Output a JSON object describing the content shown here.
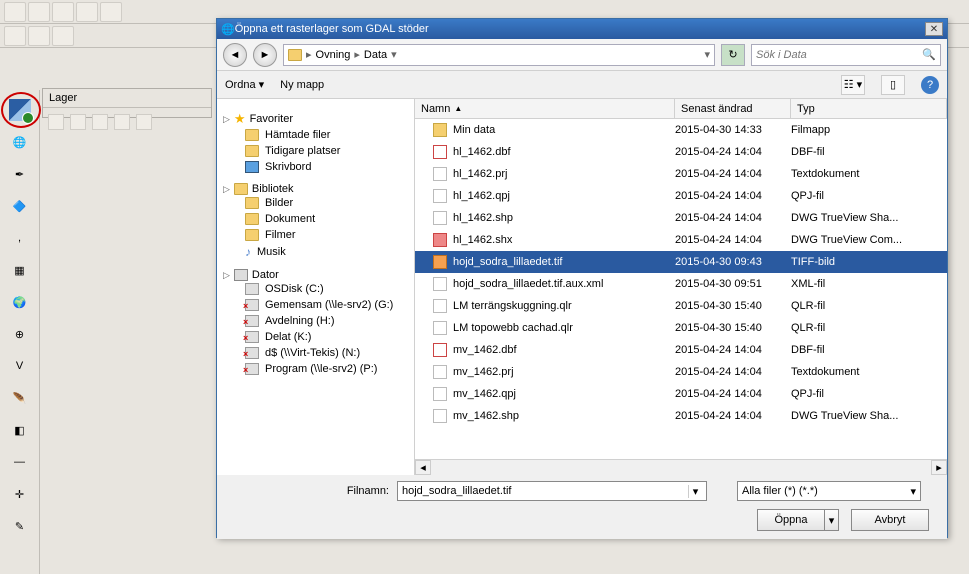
{
  "bgapp": {
    "lager_title": "Lager"
  },
  "dialog": {
    "title": "Öppna ett rasterlager som GDAL stöder",
    "breadcrumb": [
      "Ovning",
      "Data"
    ],
    "search_placeholder": "Sök i Data",
    "cmd_sort": "Ordna",
    "cmd_newfolder": "Ny mapp",
    "nav": {
      "fav_hdr": "Favoriter",
      "fav_items": [
        "Hämtade filer",
        "Tidigare platser",
        "Skrivbord"
      ],
      "lib_hdr": "Bibliotek",
      "lib_items": [
        "Bilder",
        "Dokument",
        "Filmer",
        "Musik"
      ],
      "pc_hdr": "Dator",
      "drives": [
        "OSDisk (C:)",
        "Gemensam (\\\\le-srv2) (G:)",
        "Avdelning (H:)",
        "Delat (K:)",
        "d$ (\\\\Virt-Tekis) (N:)",
        "Program (\\\\le-srv2) (P:)"
      ]
    },
    "cols": {
      "name": "Namn",
      "date": "Senast ändrad",
      "type": "Typ"
    },
    "files": [
      {
        "name": "Min data",
        "date": "2015-04-30 14:33",
        "type": "Filmapp",
        "icon": "folder",
        "sel": false
      },
      {
        "name": "hl_1462.dbf",
        "date": "2015-04-24 14:04",
        "type": "DBF-fil",
        "icon": "dbf",
        "sel": false
      },
      {
        "name": "hl_1462.prj",
        "date": "2015-04-24 14:04",
        "type": "Textdokument",
        "icon": "prj",
        "sel": false
      },
      {
        "name": "hl_1462.qpj",
        "date": "2015-04-24 14:04",
        "type": "QPJ-fil",
        "icon": "prj",
        "sel": false
      },
      {
        "name": "hl_1462.shp",
        "date": "2015-04-24 14:04",
        "type": "DWG TrueView Sha...",
        "icon": "prj",
        "sel": false
      },
      {
        "name": "hl_1462.shx",
        "date": "2015-04-24 14:04",
        "type": "DWG TrueView Com...",
        "icon": "shx",
        "sel": false
      },
      {
        "name": "hojd_sodra_lillaedet.tif",
        "date": "2015-04-30 09:43",
        "type": "TIFF-bild",
        "icon": "tif",
        "sel": true
      },
      {
        "name": "hojd_sodra_lillaedet.tif.aux.xml",
        "date": "2015-04-30 09:51",
        "type": "XML-fil",
        "icon": "prj",
        "sel": false
      },
      {
        "name": "LM terrängskuggning.qlr",
        "date": "2015-04-30 15:40",
        "type": "QLR-fil",
        "icon": "prj",
        "sel": false
      },
      {
        "name": "LM topowebb cachad.qlr",
        "date": "2015-04-30 15:40",
        "type": "QLR-fil",
        "icon": "prj",
        "sel": false
      },
      {
        "name": "mv_1462.dbf",
        "date": "2015-04-24 14:04",
        "type": "DBF-fil",
        "icon": "dbf",
        "sel": false
      },
      {
        "name": "mv_1462.prj",
        "date": "2015-04-24 14:04",
        "type": "Textdokument",
        "icon": "prj",
        "sel": false
      },
      {
        "name": "mv_1462.qpj",
        "date": "2015-04-24 14:04",
        "type": "QPJ-fil",
        "icon": "prj",
        "sel": false
      },
      {
        "name": "mv_1462.shp",
        "date": "2015-04-24 14:04",
        "type": "DWG TrueView Sha...",
        "icon": "prj",
        "sel": false
      }
    ],
    "filename_label": "Filnamn:",
    "filename_value": "hojd_sodra_lillaedet.tif",
    "filter_value": "Alla filer (*) (*.*)",
    "btn_open": "Öppna",
    "btn_cancel": "Avbryt"
  }
}
